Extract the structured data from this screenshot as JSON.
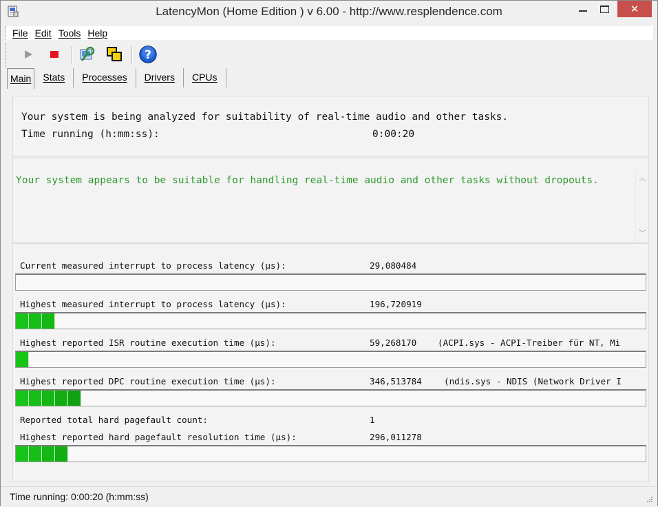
{
  "window": {
    "title": "LatencyMon  (Home Edition )  v 6.00 - http://www.resplendence.com",
    "close_glyph": "✕"
  },
  "menu": [
    {
      "label": "File"
    },
    {
      "label": "Edit"
    },
    {
      "label": "Tools"
    },
    {
      "label": "Help"
    }
  ],
  "toolbar": {
    "buttons": [
      {
        "name": "start-icon",
        "color": "#9a9a9a"
      },
      {
        "name": "stop-icon",
        "color": "#e8141e"
      },
      {
        "name": "analyze-icon",
        "color": "#2f8f3e"
      },
      {
        "name": "windows-icon",
        "color": "#f2d20c"
      },
      {
        "name": "help-icon",
        "color": "#1f5fd4"
      }
    ]
  },
  "tabs": [
    {
      "label": "Main",
      "active": true
    },
    {
      "label": "Stats"
    },
    {
      "label": "Processes"
    },
    {
      "label": "Drivers"
    },
    {
      "label": "CPUs"
    }
  ],
  "main": {
    "analysis_text": "Your system is being analyzed for suitability of real-time audio and other tasks.",
    "time_label": "Time running (h:mm:ss):",
    "time_value": "0:00:20",
    "verdict_text": "Your system appears to be suitable for handling real-time audio and other tasks without dropouts.",
    "verdict_color": "#2e9a2e"
  },
  "metrics": [
    {
      "label": "Current measured interrupt to process latency (µs):",
      "value": "29,080484",
      "extra": "",
      "segments": 0
    },
    {
      "label": "Highest measured interrupt to process latency (µs):",
      "value": "196,720919",
      "extra": "",
      "segments": 3
    },
    {
      "label": "Highest reported ISR routine execution time (µs):",
      "value": "59,268170",
      "extra": "(ACPI.sys - ACPI-Treiber für NT, Mi",
      "segments": 1
    },
    {
      "label": "Highest reported DPC routine execution time (µs):",
      "value": "346,513784",
      "extra": "(ndis.sys - NDIS (Network Driver I",
      "segments": 5
    },
    {
      "label": "Reported total hard pagefault count:",
      "value": "1",
      "extra": ""
    },
    {
      "label": "Highest reported hard pagefault resolution time (µs):",
      "value": "296,011278",
      "extra": "",
      "segments": 4
    }
  ],
  "statusbar": {
    "text": "Time running: 0:00:20  (h:mm:ss)"
  }
}
